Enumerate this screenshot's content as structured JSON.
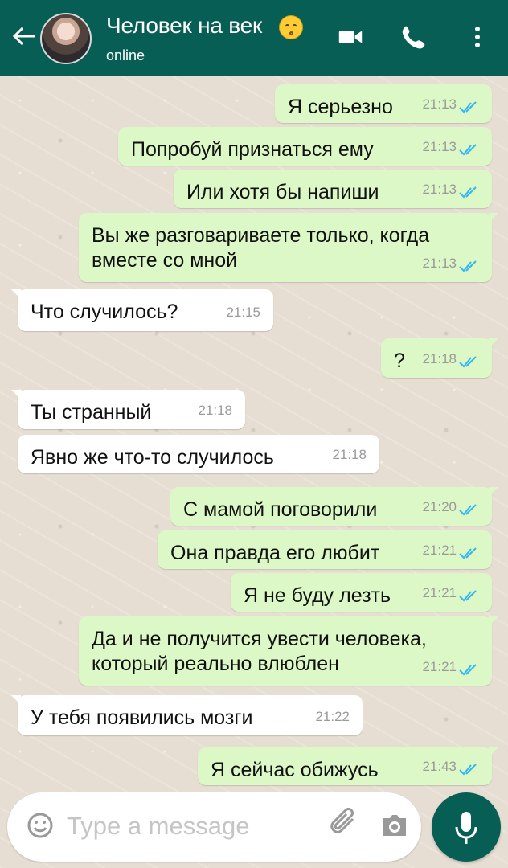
{
  "header": {
    "contact_name": "Человек на век",
    "status": "online",
    "colors": {
      "bar": "#075e54",
      "outgoing": "#dcf8c6",
      "incoming": "#ffffff",
      "read_ticks": "#34b7f1"
    }
  },
  "messages": [
    {
      "text": "Я серьезно",
      "time": "21:13"
    },
    {
      "text": "Попробуй признаться ему",
      "time": "21:13"
    },
    {
      "text": "Или хотя бы напиши",
      "time": "21:13"
    },
    {
      "text": "Вы же разговариваете только, когда вместе со мной",
      "time": "21:13"
    },
    {
      "text": "Что случилось?",
      "time": "21:15"
    },
    {
      "text": "?",
      "time": "21:18"
    },
    {
      "text": "Ты странный",
      "time": "21:18"
    },
    {
      "text": "Явно же что-то случилось",
      "time": "21:18"
    },
    {
      "text": "С мамой поговорили",
      "time": "21:20"
    },
    {
      "text": "Она правда его любит",
      "time": "21:21"
    },
    {
      "text": "Я не буду лезть",
      "time": "21:21"
    },
    {
      "text": "Да и не получится увести человека, который реально влюблен",
      "time": "21:21"
    },
    {
      "text": "У тебя появились мозги",
      "time": "21:22"
    },
    {
      "text": "Я сейчас обижусь",
      "time": "21:43"
    }
  ],
  "composer": {
    "placeholder": "Type a message"
  }
}
